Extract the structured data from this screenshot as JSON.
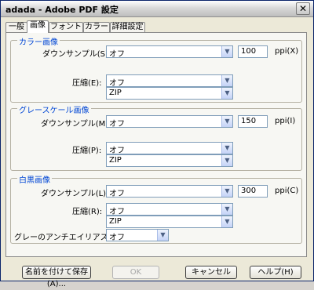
{
  "window": {
    "title": "adada - Adobe PDF 設定",
    "close_label": "✕"
  },
  "tabs": [
    "一般",
    "画像",
    "フォント",
    "カラー",
    "詳細設定"
  ],
  "color_images": {
    "title": "カラー画像",
    "downsample_label": "ダウンサンプル(S):",
    "downsample_value": "オフ",
    "resolution": "100",
    "ppi_label": "ppi(X)",
    "compression_label": "圧縮(E):",
    "compression_value": "オフ",
    "method_value": "ZIP"
  },
  "gray_images": {
    "title": "グレースケール画像",
    "downsample_label": "ダウンサンプル(M):",
    "downsample_value": "オフ",
    "resolution": "150",
    "ppi_label": "ppi(I)",
    "compression_label": "圧縮(P):",
    "compression_value": "オフ",
    "method_value": "ZIP"
  },
  "mono_images": {
    "title": "白黒画像",
    "downsample_label": "ダウンサンプル(L):",
    "downsample_value": "オフ",
    "resolution": "300",
    "ppi_label": "ppi(C)",
    "compression_label": "圧縮(R):",
    "compression_value": "オフ",
    "method_value": "ZIP",
    "antialias_label": "グレーのアンチエイリアス(G):",
    "antialias_value": "オフ"
  },
  "buttons": {
    "save_as": "名前を付けて保存(A)...",
    "ok": "OK",
    "cancel": "キャンセル",
    "help": "ヘルプ(H)"
  }
}
